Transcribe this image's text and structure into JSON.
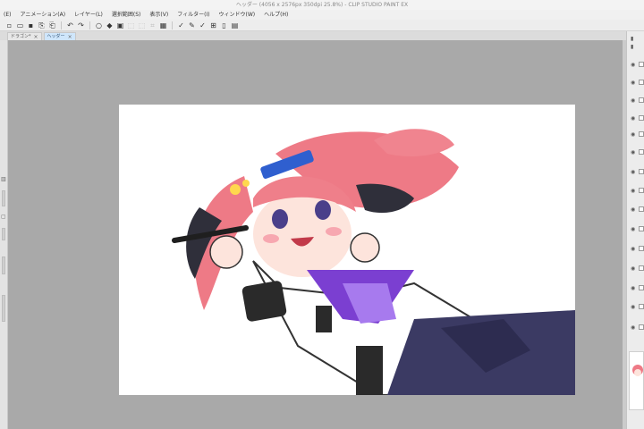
{
  "window": {
    "title": "ヘッダー (4056 x 2576px 350dpi 25.8%) - CLIP STUDIO PAINT EX"
  },
  "menu": {
    "items": [
      "(E)",
      "アニメーション(A)",
      "レイヤー(L)",
      "選択範囲(S)",
      "表示(V)",
      "フィルター(I)",
      "ウィンドウ(W)",
      "ヘルプ(H)"
    ]
  },
  "toolbar": {
    "icons": [
      "new-file-icon",
      "open-folder-icon",
      "save-icon",
      "export-icon",
      "import-icon",
      "undo-icon",
      "redo-icon",
      "clear-icon",
      "fill-icon",
      "transform-icon",
      "select-all-icon",
      "deselect-icon",
      "crop-icon",
      "show-selection-icon",
      "check-icon",
      "pen-icon",
      "lasso-icon",
      "layer-settings-icon",
      "document-icon",
      "palette-icon"
    ]
  },
  "tabs": [
    {
      "label": "ドラゴン*",
      "active": false
    },
    {
      "label": "ヘッダー",
      "active": true
    }
  ],
  "canvas": {
    "artwork": "pink-haired twin-tail anime character holding a pen"
  },
  "colors": {
    "workspace": "#a9a9a9",
    "canvas": "#ffffff",
    "active_tab": "#cfe6fb"
  }
}
